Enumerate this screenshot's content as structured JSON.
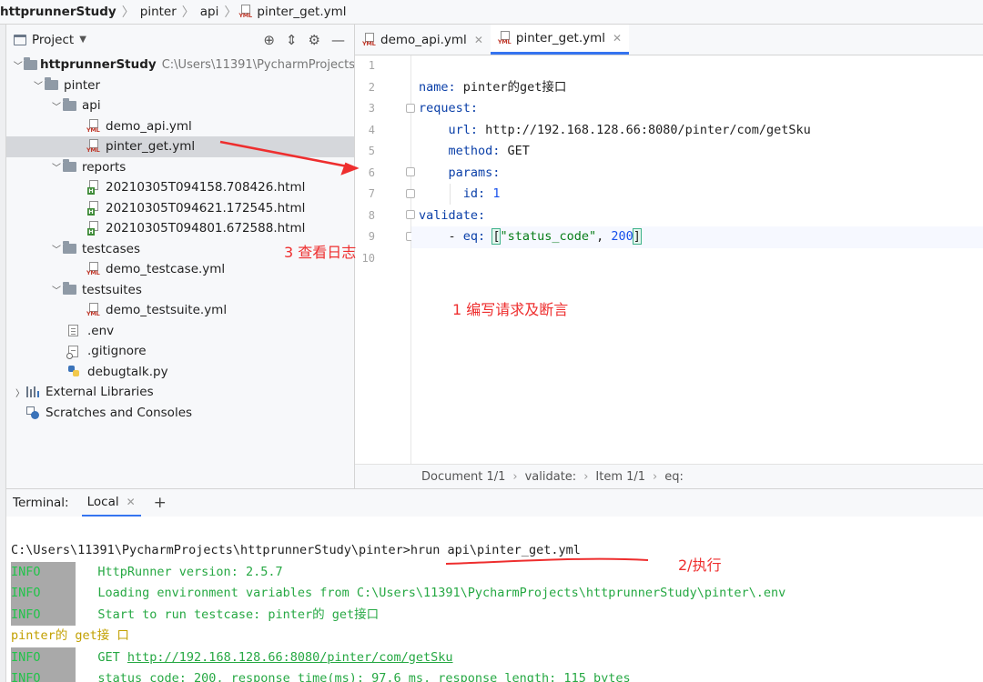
{
  "breadcrumb": {
    "items": [
      "httprunnerStudy",
      "pinter",
      "api",
      "pinter_get.yml"
    ]
  },
  "project_panel": {
    "title": "Project",
    "root_label": "httprunnerStudy",
    "root_path": "C:\\Users\\11391\\PycharmProjects",
    "folders": {
      "pinter": "pinter",
      "api": "api",
      "reports": "reports",
      "testcases": "testcases",
      "testsuites": "testsuites"
    },
    "files": {
      "demo_api": "demo_api.yml",
      "pinter_get": "pinter_get.yml",
      "report1": "20210305T094158.708426.html",
      "report2": "20210305T094621.172545.html",
      "report3": "20210305T094801.672588.html",
      "demo_testcase": "demo_testcase.yml",
      "demo_testsuite": "demo_testsuite.yml",
      "env": ".env",
      "gitignore": ".gitignore",
      "debugtalk": "debugtalk.py"
    },
    "external_libraries": "External Libraries",
    "scratches": "Scratches and Consoles"
  },
  "editor": {
    "tabs": [
      "demo_api.yml",
      "pinter_get.yml"
    ],
    "line_numbers": [
      "1",
      "2",
      "3",
      "4",
      "5",
      "6",
      "7",
      "8",
      "9",
      "10"
    ],
    "code": {
      "l2_key": "name:",
      "l2_val": " pinter的get接口",
      "l3_key": "request:",
      "l4_key": "url:",
      "l4_val": " http://192.168.128.66:8080/pinter/com/getSku",
      "l5_key": "method:",
      "l5_val": " GET",
      "l6_key": "params:",
      "l7_key": "id:",
      "l7_val": "1",
      "l8_key": "validate:",
      "l9_dash": "- ",
      "l9_key": "eq:",
      "l9_open": "[",
      "l9_str": "\"status_code\"",
      "l9_comma": ", ",
      "l9_num": "200",
      "l9_close": "]"
    },
    "status": [
      "Document 1/1",
      "validate:",
      "Item 1/1",
      "eq:"
    ]
  },
  "terminal": {
    "label": "Terminal:",
    "tab": "Local",
    "command": "C:\\Users\\11391\\PycharmProjects\\httprunnerStudy\\pinter>hrun api\\pinter_get.yml",
    "info_badge": "INFO",
    "line1": "HttpRunner version: 2.5.7",
    "line2": "Loading environment variables from C:\\Users\\11391\\PycharmProjects\\httprunnerStudy\\pinter\\.env",
    "line3": "Start to run testcase: pinter的 get接口",
    "testcase_name": "pinter的 get接 口",
    "get_prefix": "GET ",
    "get_url": "http://192.168.128.66:8080/pinter/com/getSku",
    "line5": "status_code: 200, response_time(ms): 97.6 ms, response_length: 115 bytes"
  },
  "annotations": {
    "write": "1 编写请求及断言",
    "execute": "2/执行",
    "view_log": "3 查看日志"
  },
  "colors": {
    "annotation": "#ee2e2e",
    "accent": "#3574f0",
    "terminal_green": "#26a843",
    "terminal_yellow": "#c2a000"
  }
}
